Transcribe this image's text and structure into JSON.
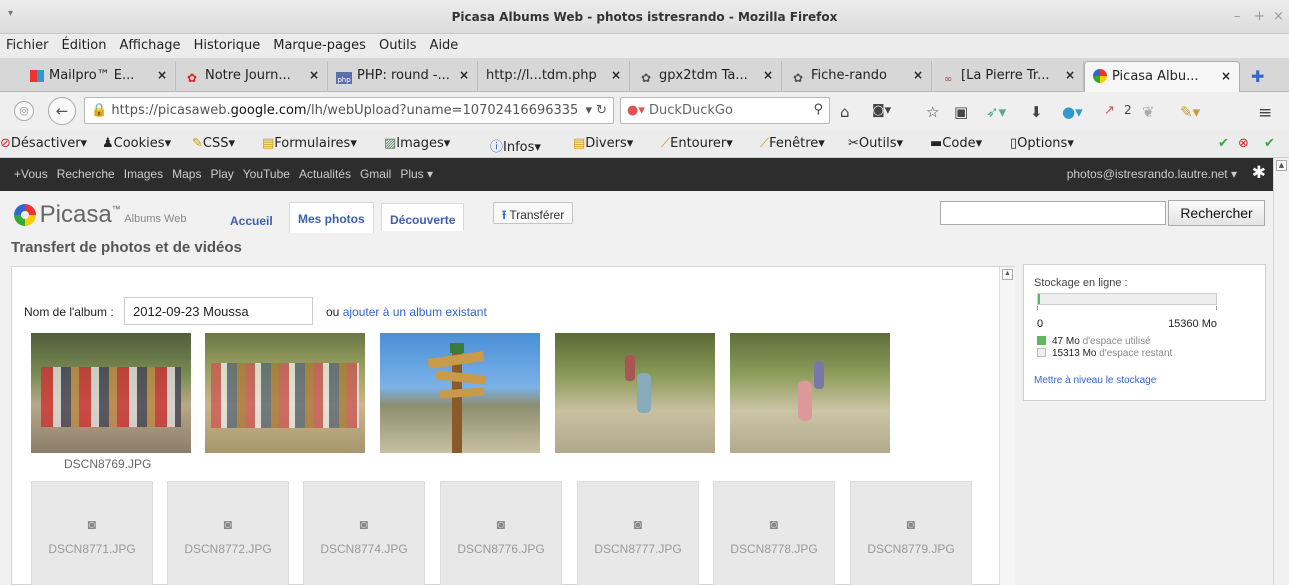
{
  "window": {
    "title": "Picasa Albums Web - photos istresrando - Mozilla Firefox",
    "controls": [
      "–",
      "+",
      "×"
    ]
  },
  "menu": [
    "Fichier",
    "Édition",
    "Affichage",
    "Historique",
    "Marque-pages",
    "Outils",
    "Aide"
  ],
  "tabs": [
    {
      "label": "Mailpro™ E...",
      "icon": "mailpro-icon"
    },
    {
      "label": "Notre Journ...",
      "icon": "hiker-icon"
    },
    {
      "label": "PHP: round -...",
      "icon": "php-icon"
    },
    {
      "label": "http://l...tdm.php",
      "icon": ""
    },
    {
      "label": "gpx2tdm Ta...",
      "icon": "hiker-icon"
    },
    {
      "label": "Fiche-rando",
      "icon": "hiker-icon"
    },
    {
      "label": "[La Pierre Tr...",
      "icon": "site-icon"
    },
    {
      "label": "Picasa Albu...",
      "icon": "picasa-icon"
    }
  ],
  "nav": {
    "url_host": "https://picasaweb.",
    "url_domain": "google.com",
    "url_path": "/lh/webUpload?uname=10702416696335",
    "search_placeholder": "DuckDuckGo",
    "badge_count": "2"
  },
  "devbar": [
    "Désactiver",
    "Cookies",
    "CSS",
    "Formulaires",
    "Images",
    "Infos",
    "Divers",
    "Entourer",
    "Fenêtre",
    "Outils",
    "Code",
    "Options"
  ],
  "google_bar": {
    "links": [
      "+Vous",
      "Recherche",
      "Images",
      "Maps",
      "Play",
      "YouTube",
      "Actualités",
      "Gmail",
      "Plus ▾"
    ],
    "account": "photos@istresrando.lautre.net ▾"
  },
  "picasa": {
    "logo_text": "Picasa",
    "logo_tm": "™",
    "logo_sub": "Albums Web",
    "tabs": [
      "Accueil",
      "Mes photos",
      "Découverte"
    ],
    "upload_button": "Transférer",
    "search_button": "Rechercher",
    "search_value": "",
    "page_title": "Transfert de photos et de vidéos",
    "album_label": "Nom de l'album :",
    "album_value": "2012-09-23 Moussa",
    "or_text": "ou",
    "existing_link": "ajouter à un album existant",
    "first_photo_name": "DSCN8769.JPG",
    "placeholders": [
      "DSCN8771.JPG",
      "DSCN8772.JPG",
      "DSCN8774.JPG",
      "DSCN8776.JPG",
      "DSCN8777.JPG",
      "DSCN8778.JPG",
      "DSCN8779.JPG"
    ],
    "storage": {
      "title": "Stockage en ligne :",
      "min": "0",
      "max": "15360 Mo",
      "used_fraction": 0.003,
      "used_value": "47 Mo",
      "used_label": "d'espace utilisé",
      "free_value": "15313 Mo",
      "free_label": "d'espace restant",
      "upgrade_link": "Mettre à niveau le stockage",
      "used_color": "#5cb85c"
    }
  }
}
